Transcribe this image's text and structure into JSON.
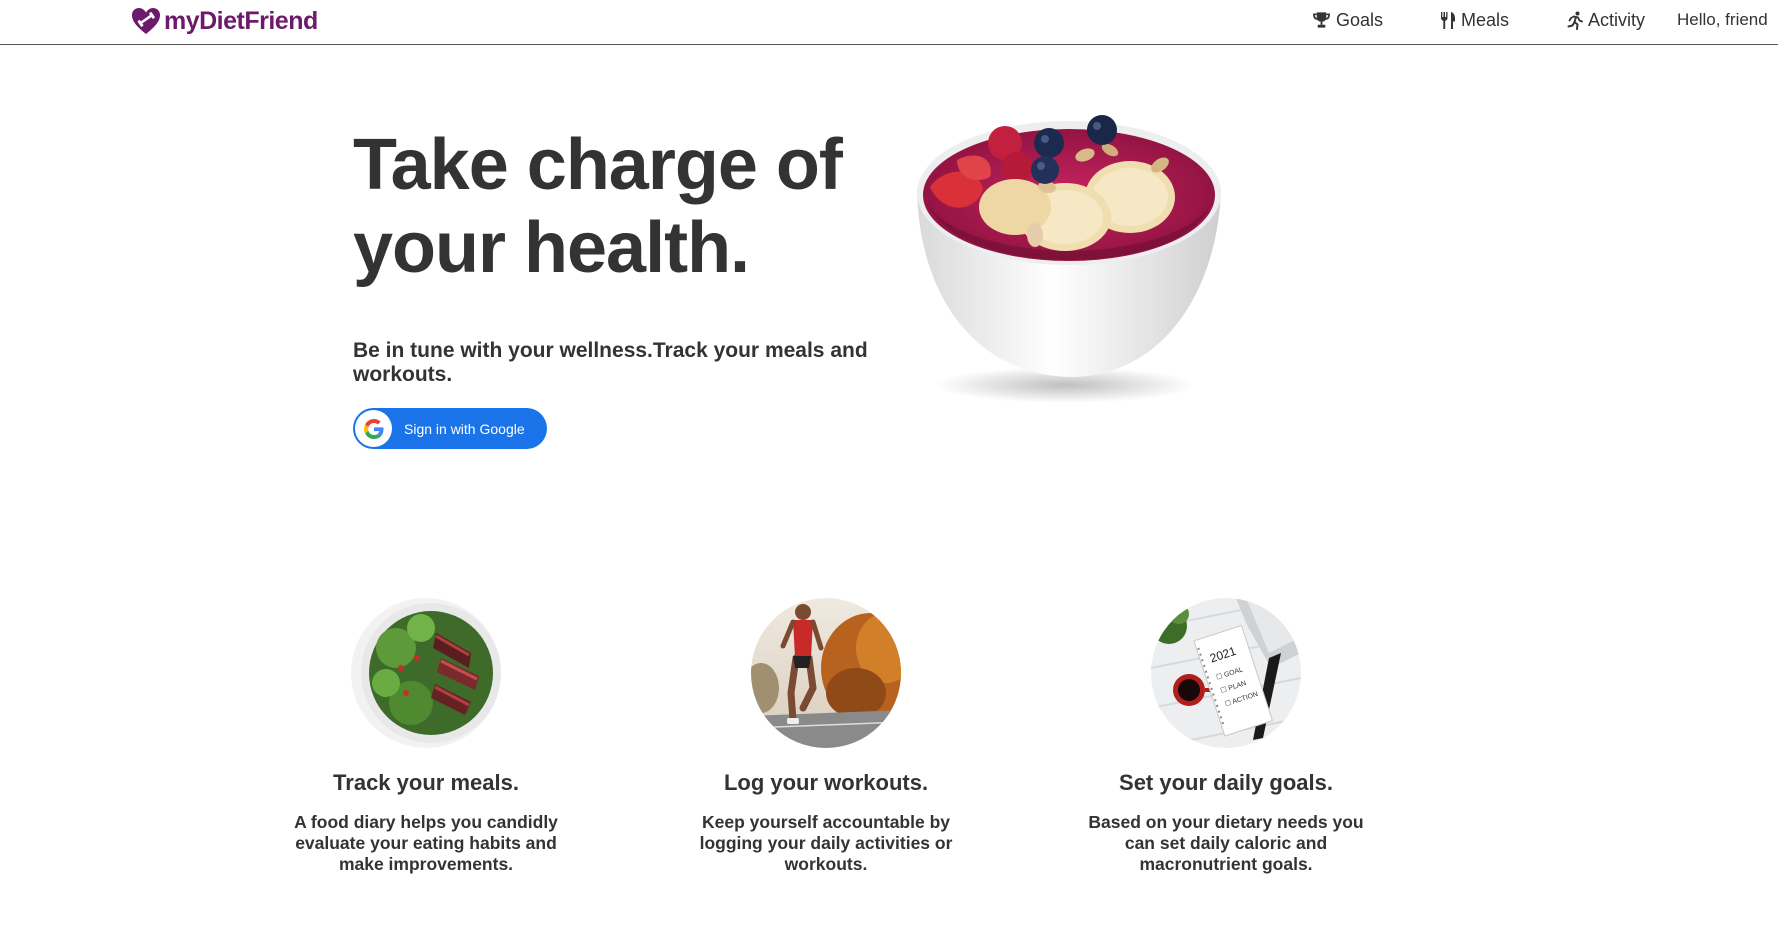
{
  "header": {
    "brand": "myDietFriend",
    "nav": {
      "goals": "Goals",
      "meals": "Meals",
      "activity": "Activity"
    },
    "greeting": "Hello, friend"
  },
  "hero": {
    "title": "Take charge of your health.",
    "subtitle": "Be in tune with your wellness.Track your meals and workouts.",
    "signin_label": "Sign in with Google"
  },
  "features": [
    {
      "title": "Track your meals.",
      "text": "A food diary helps you candidly evaluate your eating habits and make improvements."
    },
    {
      "title": "Log your workouts.",
      "text": "Keep yourself accountable by logging your daily activities or workouts."
    },
    {
      "title": "Set your daily goals.",
      "text": "Based on your dietary needs you can set daily caloric and macronutrient goals."
    }
  ],
  "images": {
    "smoothie_bowl_text": "",
    "goals_note_text": "2021 GOAL PLAN ACTION"
  },
  "colors": {
    "brand": "#6d1a6a",
    "text": "#333333",
    "google_button": "#1a73e8"
  },
  "icons": {
    "brand": "heart-dumbbell-icon",
    "goals": "trophy-icon",
    "meals": "utensils-icon",
    "activity": "running-icon",
    "google": "google-g-icon"
  }
}
